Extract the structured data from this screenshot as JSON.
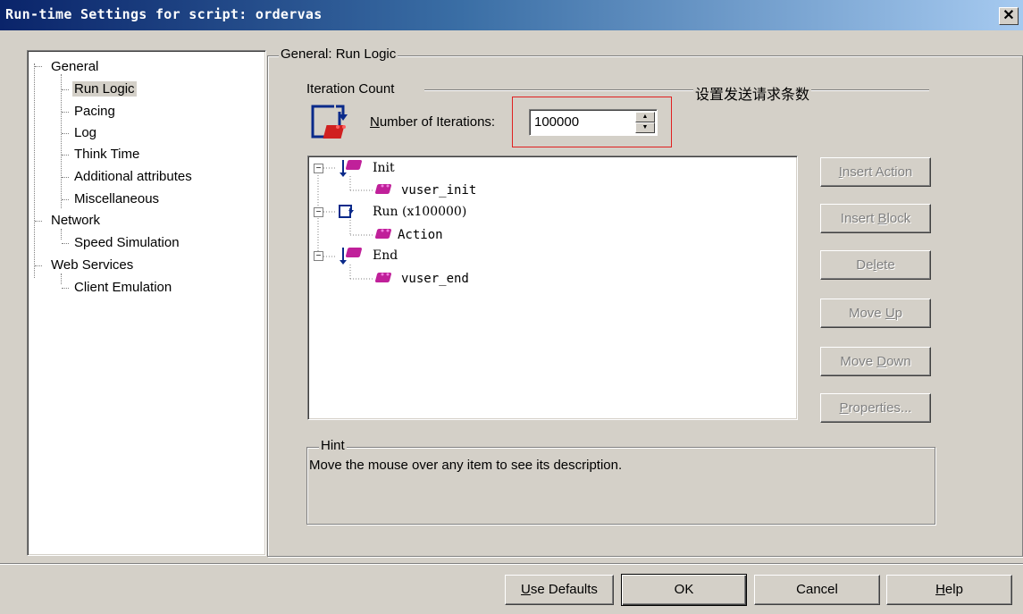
{
  "window": {
    "title": "Run-time Settings for script: ordervas"
  },
  "nav": {
    "items": [
      {
        "label": "General",
        "level": 0
      },
      {
        "label": "Run Logic",
        "level": 1,
        "selected": true
      },
      {
        "label": "Pacing",
        "level": 1
      },
      {
        "label": "Log",
        "level": 1
      },
      {
        "label": "Think Time",
        "level": 1
      },
      {
        "label": "Additional attributes",
        "level": 1
      },
      {
        "label": "Miscellaneous",
        "level": 1
      },
      {
        "label": "Network",
        "level": 0
      },
      {
        "label": "Speed Simulation",
        "level": 1
      },
      {
        "label": "Web Services",
        "level": 0
      },
      {
        "label": "Client Emulation",
        "level": 1
      }
    ]
  },
  "panel": {
    "title": "General: Run Logic",
    "iteration_count_label": "Iteration Count",
    "annotation": "设置发送请求条数",
    "iterations_label_accel": "N",
    "iterations_label_rest": "umber of Iterations:",
    "iterations_value": "100000"
  },
  "tree": {
    "nodes": [
      {
        "label": "Init",
        "icon": "brick-icon"
      },
      {
        "label": "vuser_init",
        "icon": "brick-icon"
      },
      {
        "label": "Run (x100000)",
        "icon": "loop-arrow-icon"
      },
      {
        "label": "Action",
        "icon": "brick-icon"
      },
      {
        "label": "End",
        "icon": "brick-icon"
      },
      {
        "label": "vuser_end",
        "icon": "brick-icon"
      }
    ]
  },
  "actions": {
    "insert_action_accel": "I",
    "insert_action_rest": "nsert Action",
    "insert_block_pre": "Insert ",
    "insert_block_accel": "B",
    "insert_block_rest": "lock",
    "delete_pre": "De",
    "delete_accel": "l",
    "delete_rest": "ete",
    "move_up_pre": "Move ",
    "move_up_accel": "U",
    "move_up_rest": "p",
    "move_down_pre": "Move ",
    "move_down_accel": "D",
    "move_down_rest": "own",
    "properties_accel": "P",
    "properties_rest": "roperties..."
  },
  "hint": {
    "title": "Hint",
    "text": "Move the mouse over any item to see its description."
  },
  "footer": {
    "use_defaults_accel": "U",
    "use_defaults_rest": "se Defaults",
    "ok": "OK",
    "cancel": "Cancel",
    "help_accel": "H",
    "help_rest": "elp"
  },
  "colors": {
    "title_start": "#0a246a",
    "title_end": "#a6caf0",
    "face": "#d4d0c8",
    "annotation_box": "#e02020",
    "brick": "#c0209a"
  }
}
